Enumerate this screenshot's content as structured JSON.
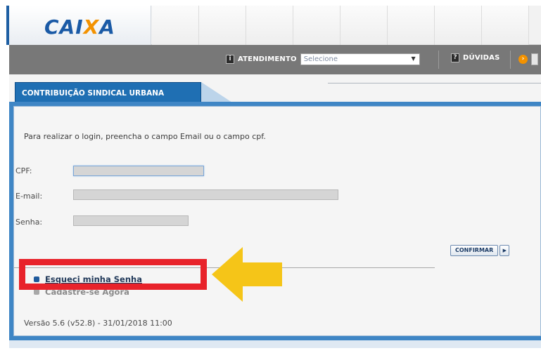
{
  "brand": {
    "logo_text_a": "CAI",
    "logo_text_x": "X",
    "logo_text_b": "A",
    "accent_color": "#1a5aa6",
    "accent_orange": "#f39200"
  },
  "nav": {
    "atendimento_label": "ATENDIMENTO",
    "atendimento_select_value": "Selecione",
    "duvidas_label": "DÚVIDAS",
    "info_icon": "info-icon",
    "arrow_icon": "orange-arrow-icon"
  },
  "tab": {
    "label": "CONTRIBUIÇÃO SINDICAL URBANA"
  },
  "form": {
    "instructions": "Para realizar o login, preencha o campo Email ou o campo cpf.",
    "cpf_label": "CPF:",
    "email_label": "E-mail:",
    "senha_label": "Senha:",
    "confirm_label": "CONFIRMAR",
    "confirm_arrow": "▶"
  },
  "links": {
    "forgot_password": "Esqueci minha Senha",
    "register": "Cadastre-se Agora"
  },
  "version": "Versão 5.6 (v52.8) - 31/01/2018 11:00",
  "annotation": {
    "highlight_color": "#e8232b",
    "arrow_color": "#f5c518"
  }
}
